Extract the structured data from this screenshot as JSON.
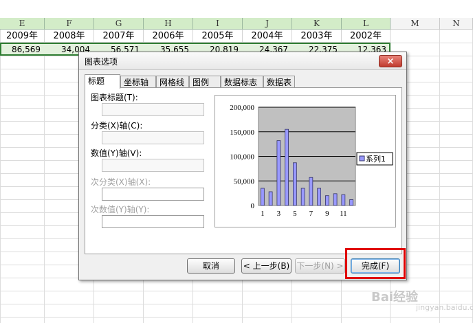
{
  "sheet": {
    "columns": [
      {
        "letter": "E",
        "selected": true
      },
      {
        "letter": "F",
        "selected": true
      },
      {
        "letter": "G",
        "selected": true
      },
      {
        "letter": "H",
        "selected": true
      },
      {
        "letter": "I",
        "selected": true
      },
      {
        "letter": "J",
        "selected": true
      },
      {
        "letter": "K",
        "selected": true
      },
      {
        "letter": "L",
        "selected": true
      },
      {
        "letter": "M",
        "selected": false
      },
      {
        "letter": "N",
        "selected": false
      }
    ],
    "year_row": [
      "2009年",
      "2008年",
      "2007年",
      "2006年",
      "2005年",
      "2004年",
      "2003年",
      "2002年"
    ],
    "value_row": [
      "86,569",
      "34,004",
      "56,571",
      "35,655",
      "20,819",
      "24,367",
      "22,375",
      "12,363"
    ]
  },
  "dialog": {
    "title": "图表选项",
    "close_label": "×",
    "tabs": [
      "标题",
      "坐标轴",
      "网格线",
      "图例",
      "数据标志",
      "数据表"
    ],
    "active_tab": 0,
    "fields": [
      {
        "label": "图表标题(T):",
        "disabled": false,
        "value": ""
      },
      {
        "label": "分类(X)轴(C):",
        "disabled": false,
        "value": ""
      },
      {
        "label": "数值(Y)轴(V):",
        "disabled": false,
        "value": ""
      },
      {
        "label": "次分类(X)轴(X):",
        "disabled": true,
        "value": ""
      },
      {
        "label": "次数值(Y)轴(Y):",
        "disabled": true,
        "value": ""
      }
    ],
    "buttons": {
      "cancel": "取消",
      "prev": "< 上一步(B)",
      "next": "下一步(N) >",
      "finish": "完成(F)"
    }
  },
  "watermark": {
    "brand": "Bai经验",
    "url": "jingyan.baidu.com"
  },
  "chart_data": {
    "type": "bar",
    "categories": [
      "1",
      "2",
      "3",
      "4",
      "5",
      "6",
      "7",
      "8",
      "9",
      "10",
      "11",
      "12"
    ],
    "x_tick_labels": [
      "1",
      "3",
      "5",
      "7",
      "9",
      "11"
    ],
    "series": [
      {
        "name": "系列1",
        "values": [
          35000,
          28000,
          132000,
          155000,
          87000,
          35000,
          57000,
          35000,
          20000,
          24000,
          22000,
          12000
        ],
        "color": "#9999ff"
      }
    ],
    "y_ticks": [
      "0",
      "50,000",
      "100,000",
      "150,000",
      "200,000"
    ],
    "ylim": [
      0,
      200000
    ],
    "grid": true,
    "legend": "right",
    "plot_bg": "#c0c0c0"
  }
}
